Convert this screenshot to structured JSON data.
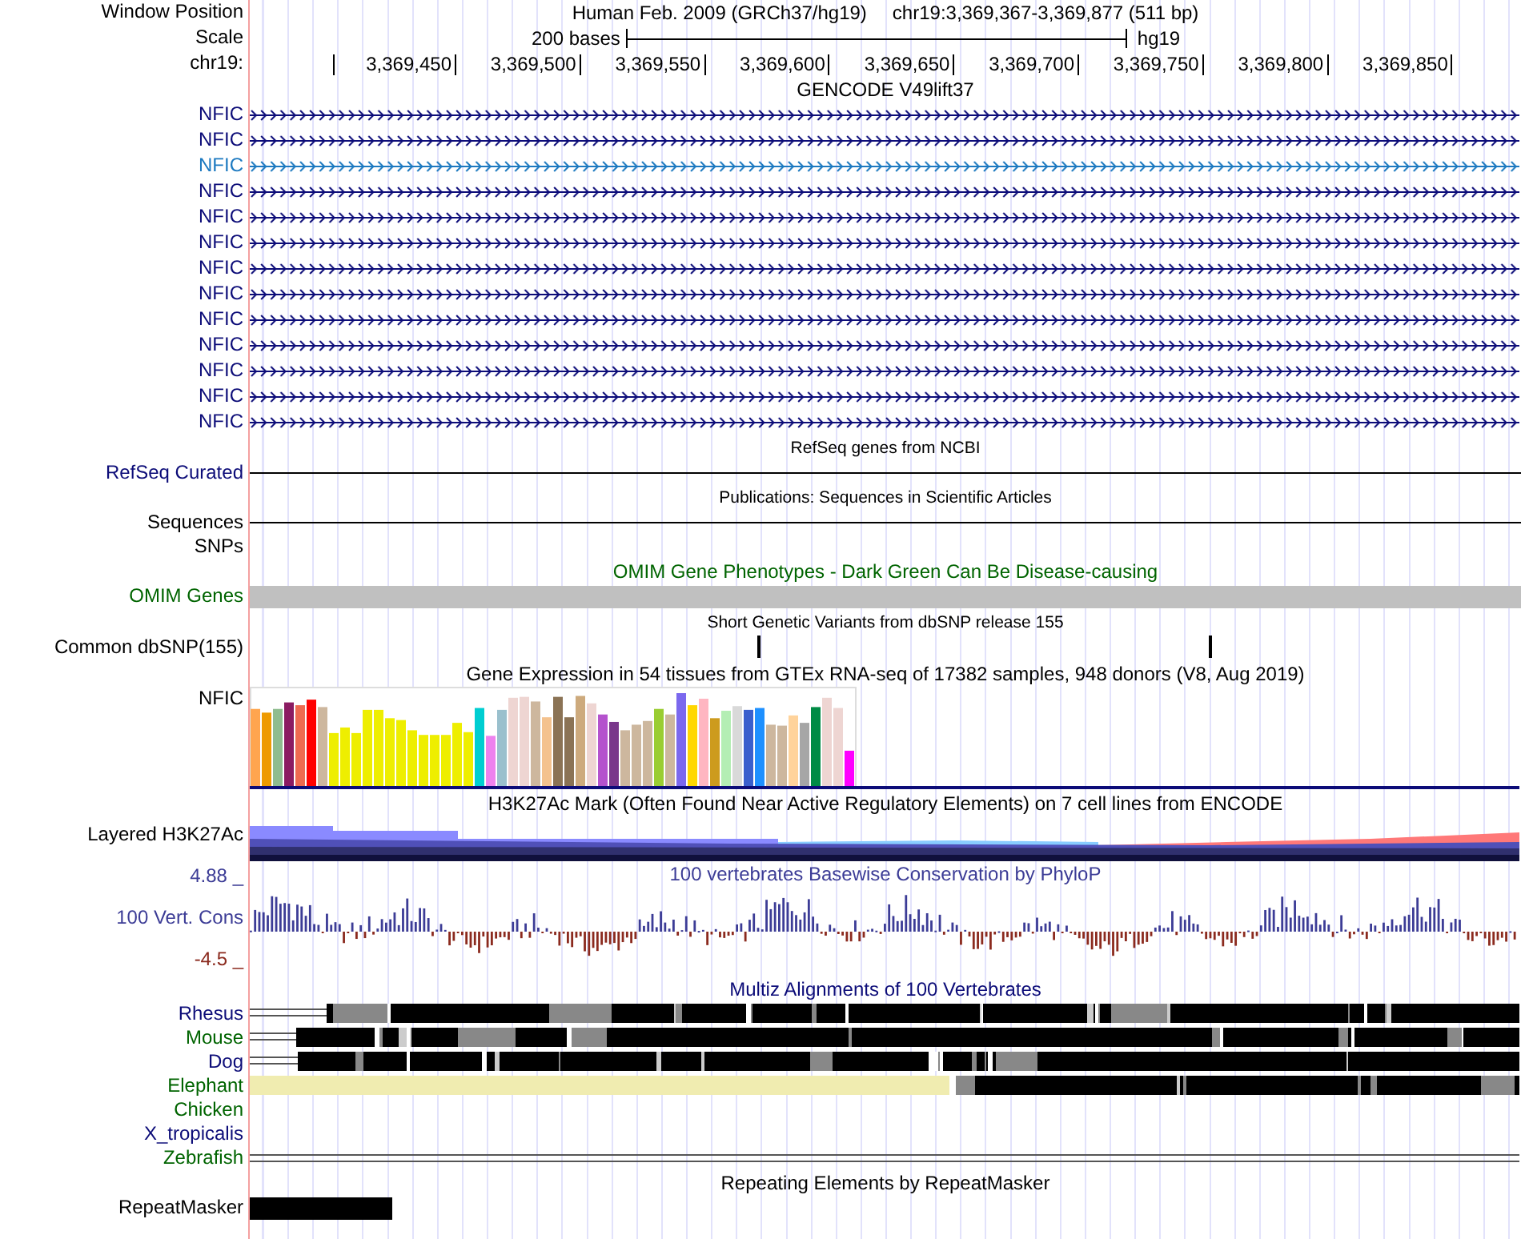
{
  "position": {
    "label": "Window Position",
    "assembly": "Human Feb. 2009 (GRCh37/hg19)",
    "range": "chr19:3,369,367-3,369,877 (511 bp)"
  },
  "scale": {
    "label": "Scale",
    "span": "200 bases",
    "db": "hg19"
  },
  "ruler": {
    "label": "chr19:",
    "ticks": [
      "3,369,450",
      "3,369,500",
      "3,369,550",
      "3,369,600",
      "3,369,650",
      "3,369,700",
      "3,369,750",
      "3,369,800",
      "3,369,850"
    ]
  },
  "tracks": [
    {
      "kind": "genes",
      "title": "GENCODE V49lift37",
      "genes": [
        {
          "name": "NFIC",
          "color": "#0c0c78"
        },
        {
          "name": "NFIC",
          "color": "#0c0c78"
        },
        {
          "name": "NFIC",
          "color": "#1c79c0"
        },
        {
          "name": "NFIC",
          "color": "#0c0c78"
        },
        {
          "name": "NFIC",
          "color": "#0c0c78"
        },
        {
          "name": "NFIC",
          "color": "#0c0c78"
        },
        {
          "name": "NFIC",
          "color": "#0c0c78"
        },
        {
          "name": "NFIC",
          "color": "#0c0c78"
        },
        {
          "name": "NFIC",
          "color": "#0c0c78"
        },
        {
          "name": "NFIC",
          "color": "#0c0c78"
        },
        {
          "name": "NFIC",
          "color": "#0c0c78"
        },
        {
          "name": "NFIC",
          "color": "#0c0c78"
        },
        {
          "name": "NFIC",
          "color": "#0c0c78"
        }
      ]
    },
    {
      "kind": "line",
      "title": "RefSeq genes from NCBI",
      "label": "RefSeq Curated",
      "color": "#0c0c78"
    },
    {
      "kind": "line",
      "title": "Publications: Sequences in Scientific Articles",
      "label": "Sequences",
      "color": "#000000"
    },
    {
      "kind": "empty",
      "label": "SNPs",
      "color": "#000000"
    },
    {
      "kind": "bar",
      "title": "OMIM Gene Phenotypes - Dark Green Can Be Disease-causing",
      "label": "OMIM Genes",
      "color": "#006400"
    },
    {
      "kind": "snp",
      "title": "Short Genetic Variants from dbSNP release 155",
      "label": "Common dbSNP(155)",
      "color": "#000000"
    },
    {
      "kind": "expression",
      "title": "Gene Expression in 54 tissues from GTEx RNA-seq of 17382 samples, 948 donors (V8, Aug 2019)",
      "label": "NFIC",
      "color": "#000000"
    },
    {
      "kind": "layered",
      "title": "H3K27Ac Mark (Often Found Near Active Regulatory Elements) on 7 cell lines from ENCODE",
      "label": "Layered H3K27Ac",
      "color": "#000000"
    },
    {
      "kind": "wiggle",
      "title": "100 vertebrates Basewise Conservation by PhyloP",
      "label": "100 Vert. Cons",
      "color": "#3c3c96",
      "max_label": "4.88 _",
      "min_label": "-4.5 _"
    },
    {
      "kind": "multiz",
      "title": "Multiz Alignments of 100 Vertebrates",
      "color": "#0c0c78",
      "species": [
        {
          "name": "Rhesus",
          "color": "#0c0c78",
          "kind": "blocks"
        },
        {
          "name": "Mouse",
          "color": "#006400",
          "kind": "blocks"
        },
        {
          "name": "Dog",
          "color": "#0c0c78",
          "kind": "blocks"
        },
        {
          "name": "Elephant",
          "color": "#006400",
          "kind": "partial"
        },
        {
          "name": "Chicken",
          "color": "#006400",
          "kind": "empty"
        },
        {
          "name": "X_tropicalis",
          "color": "#0c0c78",
          "kind": "empty"
        },
        {
          "name": "Zebrafish",
          "color": "#006400",
          "kind": "line"
        }
      ]
    },
    {
      "kind": "repeats",
      "title": "Repeating Elements by RepeatMasker",
      "label": "RepeatMasker",
      "color": "#000000"
    }
  ]
}
